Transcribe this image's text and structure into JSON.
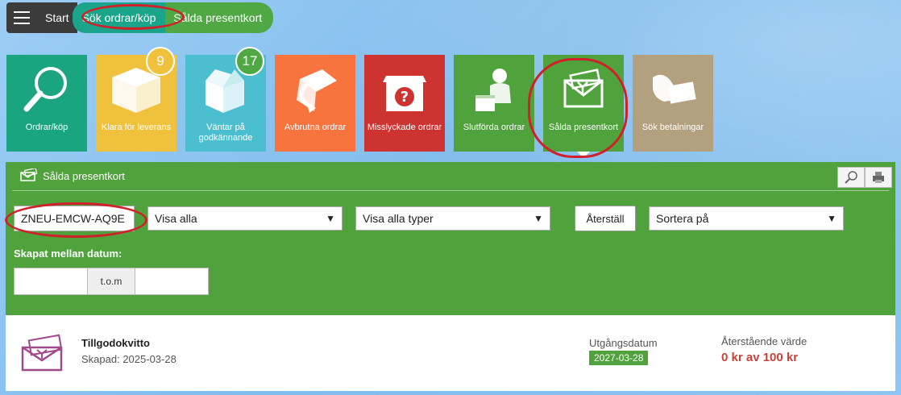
{
  "nav": {
    "start": "Start",
    "search_orders": "Sök ordrar/köp",
    "gift_cards": "Sålda presentkort"
  },
  "tiles": [
    {
      "label": "Ordrar/köp",
      "color": "#1aa580",
      "icon": "magnifier-icon"
    },
    {
      "label": "Klara för leverans",
      "color": "#efc13d",
      "badge": "9",
      "badge_color": "#efc13d",
      "icon": "box-icon"
    },
    {
      "label": "Väntar på godkännande",
      "color": "#4bbfcf",
      "badge": "17",
      "badge_color": "#4fa843",
      "icon": "open-box-icon"
    },
    {
      "label": "Avbrutna ordrar",
      "color": "#f7743f",
      "icon": "cancel-box-icon"
    },
    {
      "label": "Misslyckade ordrar",
      "color": "#cc3331",
      "icon": "question-box-icon"
    },
    {
      "label": "Slutförda ordrar",
      "color": "#4fa23c",
      "icon": "delivery-man-icon"
    },
    {
      "label": "Sålda presentkort",
      "color": "#4fa23c",
      "icon": "gift-envelope-icon"
    },
    {
      "label": "Sök betalningar",
      "color": "#b3a07e",
      "icon": "hand-money-icon"
    }
  ],
  "panel": {
    "title": "Sålda presentkort",
    "search_value": "ZNEU-EMCW-AQ9E",
    "filter_status": "Visa alla",
    "filter_type": "Visa alla typer",
    "reset_label": "Återställ",
    "sort_label": "Sortera på",
    "date_label": "Skapat mellan datum:",
    "date_separator": "t.o.m"
  },
  "result": {
    "title": "Tillgodokvitto",
    "created": "Skapad: 2025-03-28",
    "expiry_label": "Utgångsdatum",
    "expiry_value": "2027-03-28",
    "remaining_label": "Återstående värde",
    "remaining_value": "0 kr av 100 kr"
  },
  "colors": {
    "accent_green": "#4fa23c",
    "teal": "#1aa58a",
    "annotation_red": "#d0202a"
  }
}
